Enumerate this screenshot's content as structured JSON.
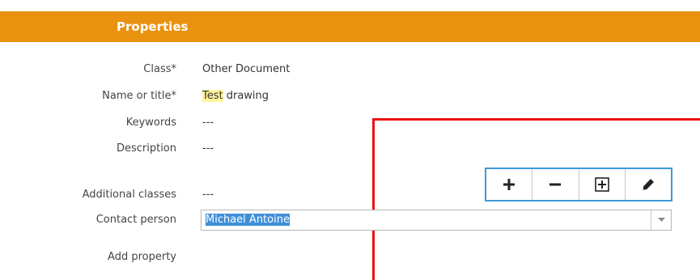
{
  "header": {
    "title": "Properties"
  },
  "properties": [
    {
      "label": "Class*",
      "value": "Other Document"
    },
    {
      "label": "Name or title*",
      "value_highlight": "Test",
      "value_rest": " drawing"
    },
    {
      "label": "Keywords",
      "value": "---"
    },
    {
      "label": "Description",
      "value": "---"
    },
    {
      "label": "Additional classes",
      "value": "---"
    },
    {
      "label": "Contact person",
      "value": "Michael Antoine"
    },
    {
      "label": "Add property"
    }
  ],
  "toolbar": {
    "buttons": [
      {
        "name": "add",
        "icon": "plus-icon"
      },
      {
        "name": "remove",
        "icon": "minus-icon"
      },
      {
        "name": "expand",
        "icon": "boxed-plus-icon"
      },
      {
        "name": "edit",
        "icon": "pencil-icon"
      }
    ],
    "border_color": "#3d9ad8"
  },
  "colors": {
    "header_bg": "#e8920f",
    "annotation_red": "#ee1111",
    "selection_bg": "#3f8fd8",
    "highlight": "#fff59c"
  }
}
